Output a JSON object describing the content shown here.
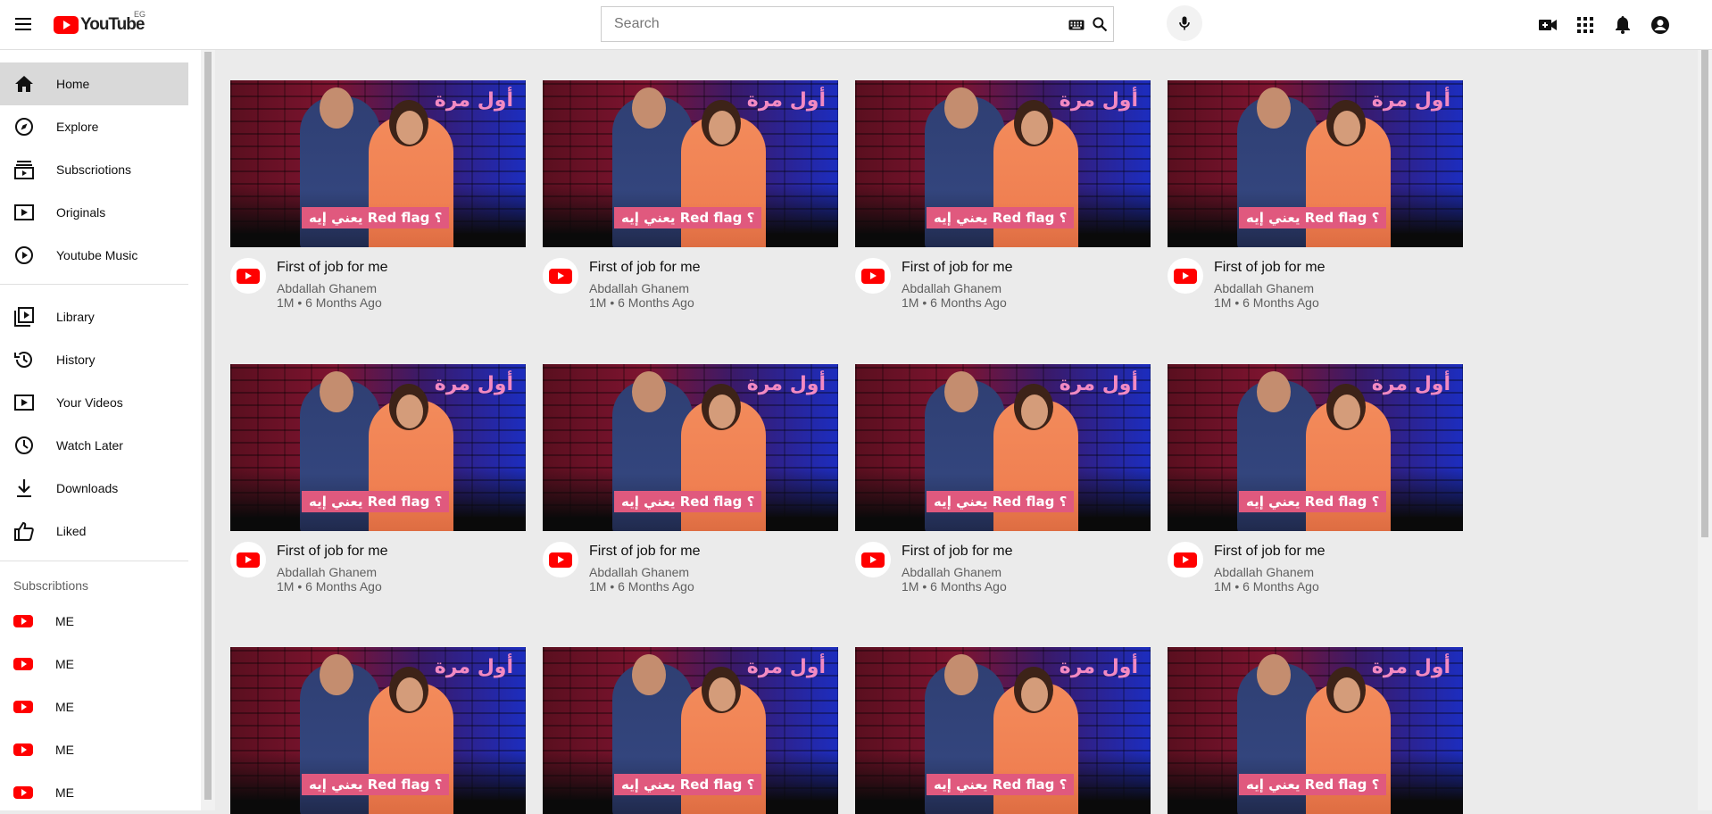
{
  "header": {
    "logo_text": "YouTube",
    "country_code": "EG",
    "search_placeholder": "Search",
    "icons": [
      "menu-icon",
      "keyboard-icon",
      "search-icon",
      "mic-icon",
      "create-video-icon",
      "apps-icon",
      "notifications-icon",
      "account-icon"
    ]
  },
  "sidebar": {
    "main": [
      {
        "label": "Home",
        "icon": "home-icon",
        "active": true
      },
      {
        "label": "Explore",
        "icon": "compass-icon"
      },
      {
        "label": "Subscriotions",
        "icon": "subscriptions-icon"
      },
      {
        "label": "Originals",
        "icon": "originals-icon"
      },
      {
        "label": "Youtube Music",
        "icon": "music-icon"
      }
    ],
    "library": [
      {
        "label": "Library",
        "icon": "library-icon"
      },
      {
        "label": "History",
        "icon": "history-icon"
      },
      {
        "label": "Your Videos",
        "icon": "your-videos-icon"
      },
      {
        "label": "Watch Later",
        "icon": "watch-later-icon"
      },
      {
        "label": "Downloads",
        "icon": "download-icon"
      },
      {
        "label": "Liked",
        "icon": "thumbs-up-icon"
      }
    ],
    "subscriptions_title": "Subscribtions",
    "subscriptions": [
      {
        "label": "ME"
      },
      {
        "label": "ME"
      },
      {
        "label": "ME"
      },
      {
        "label": "ME"
      },
      {
        "label": "ME"
      }
    ]
  },
  "videos": [
    {
      "title": "First of job for me",
      "channel": "Abdallah Ghanem",
      "stats": "1M • 6 Months Ago",
      "thumb_brand": "أول مرة",
      "thumb_banner": "يعني إيه Red flag ؟"
    },
    {
      "title": "First of job for me",
      "channel": "Abdallah Ghanem",
      "stats": "1M • 6 Months Ago",
      "thumb_brand": "أول مرة",
      "thumb_banner": "يعني إيه Red flag ؟"
    },
    {
      "title": "First of job for me",
      "channel": "Abdallah Ghanem",
      "stats": "1M • 6 Months Ago",
      "thumb_brand": "أول مرة",
      "thumb_banner": "يعني إيه Red flag ؟"
    },
    {
      "title": "First of job for me",
      "channel": "Abdallah Ghanem",
      "stats": "1M • 6 Months Ago",
      "thumb_brand": "أول مرة",
      "thumb_banner": "يعني إيه Red flag ؟"
    },
    {
      "title": "First of job for me",
      "channel": "Abdallah Ghanem",
      "stats": "1M • 6 Months Ago",
      "thumb_brand": "أول مرة",
      "thumb_banner": "يعني إيه Red flag ؟"
    },
    {
      "title": "First of job for me",
      "channel": "Abdallah Ghanem",
      "stats": "1M • 6 Months Ago",
      "thumb_brand": "أول مرة",
      "thumb_banner": "يعني إيه Red flag ؟"
    },
    {
      "title": "First of job for me",
      "channel": "Abdallah Ghanem",
      "stats": "1M • 6 Months Ago",
      "thumb_brand": "أول مرة",
      "thumb_banner": "يعني إيه Red flag ؟"
    },
    {
      "title": "First of job for me",
      "channel": "Abdallah Ghanem",
      "stats": "1M • 6 Months Ago",
      "thumb_brand": "أول مرة",
      "thumb_banner": "يعني إيه Red flag ؟"
    },
    {
      "title": "",
      "channel": "",
      "stats": "",
      "thumb_brand": "أول مرة",
      "thumb_banner": "يعني إيه Red flag ؟"
    },
    {
      "title": "",
      "channel": "",
      "stats": "",
      "thumb_brand": "أول مرة",
      "thumb_banner": "يعني إيه Red flag ؟"
    },
    {
      "title": "",
      "channel": "",
      "stats": "",
      "thumb_brand": "أول مرة",
      "thumb_banner": "يعني إيه Red flag ؟"
    },
    {
      "title": "",
      "channel": "",
      "stats": "",
      "thumb_brand": "أول مرة",
      "thumb_banner": "يعني إيه Red flag ؟"
    }
  ],
  "colors": {
    "brand_red": "#ff0000",
    "active_bg": "#d9d9d9",
    "page_bg": "#ebebeb",
    "banner_pink": "#e0597e"
  }
}
